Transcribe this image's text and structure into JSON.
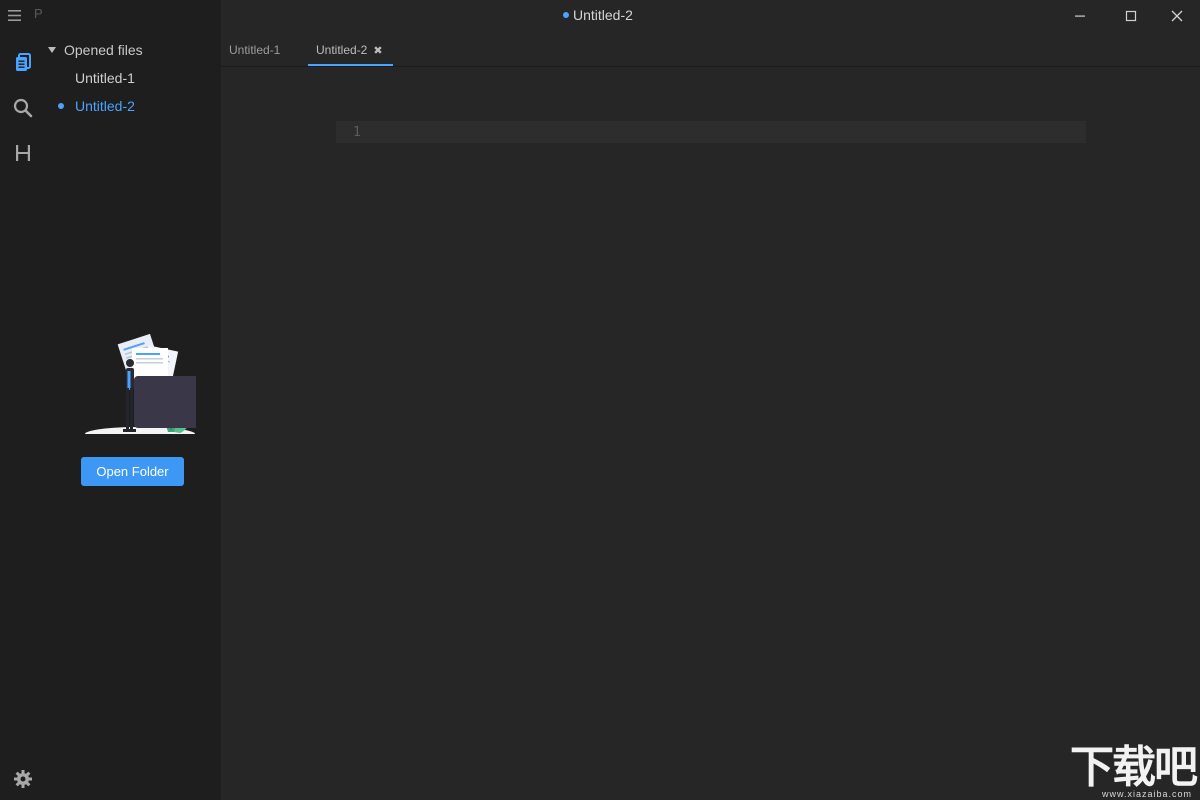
{
  "app": {
    "top_meta": "P 0",
    "window_title": "Untitled-2",
    "window_title_dirty": true
  },
  "sidebar": {
    "section_title": "Opened files",
    "files": [
      {
        "label": "Untitled-1",
        "active": false,
        "unsaved": false
      },
      {
        "label": "Untitled-2",
        "active": true,
        "unsaved": true
      }
    ],
    "open_folder_label": "Open Folder"
  },
  "tabs": [
    {
      "label": "Untitled-1",
      "active": false
    },
    {
      "label": "Untitled-2",
      "active": true,
      "close_icon": "close-icon"
    }
  ],
  "editor": {
    "line_numbers": [
      "1"
    ],
    "content": ""
  },
  "icons": {
    "menu": "menu-icon",
    "files": "files-icon",
    "search": "search-icon",
    "heading": "heading-icon",
    "settings": "gear-icon",
    "minimize": "minimize-icon",
    "maximize": "maximize-icon",
    "close": "close-icon"
  },
  "colors": {
    "accent": "#4aa3ff",
    "button": "#3d97f5",
    "sidebar_bg": "#1e1e1e",
    "editor_bg": "#262626"
  },
  "watermark": {
    "main": "下载吧",
    "sub": "www.xiazaiba.com"
  }
}
